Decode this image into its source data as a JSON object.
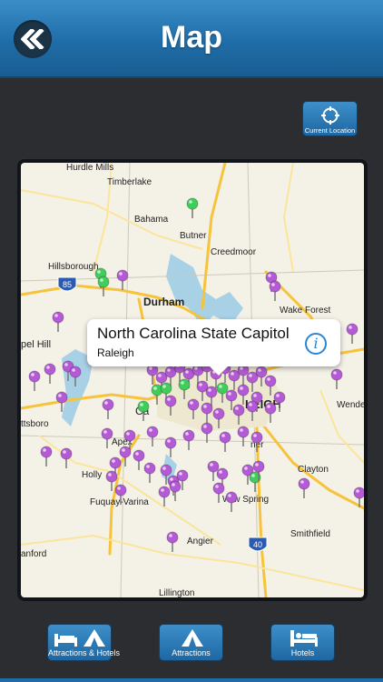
{
  "header": {
    "title": "Map",
    "back_icon": "double-chevron-left-icon"
  },
  "location_button": {
    "label": "Current Location",
    "icon": "crosshair-icon"
  },
  "callout": {
    "title": "North Carolina State Capitol",
    "subtitle": "Raleigh",
    "icon": "info-icon"
  },
  "map_labels": {
    "hurdle_mills": "Hurdle Mills",
    "timberlake": "Timberlake",
    "bahama": "Bahama",
    "butner": "Butner",
    "creedmoor": "Creedmoor",
    "hillsborough": "Hillsborough",
    "durham": "Durham",
    "wake_forest": "Wake Forest",
    "chapel_hill": "pel Hill",
    "raleigh": "LEIGH",
    "cary": "Ca",
    "apex": "Apex",
    "pittsboro": "ttsboro",
    "holly_springs": "Holly",
    "fuquay": "Fuquay-Varina",
    "garner": "ner",
    "clayton": "Clayton",
    "willow_spring": "W    w Spring",
    "angier": "Angier",
    "smithfield": "Smithfield",
    "sanford": "anford",
    "lillington": "Lillington",
    "wendell": "Wende",
    "i85": "85",
    "i40": "40"
  },
  "tabs": [
    {
      "label": "Attractions & Hotels",
      "icon": "bed-and-tent-icon"
    },
    {
      "label": "Attractions",
      "icon": "tent-icon"
    },
    {
      "label": "Hotels",
      "icon": "bed-icon"
    }
  ],
  "colors": {
    "nav": "#1f6da8",
    "pin_purple": "#b45ad6",
    "pin_green": "#3fce5a",
    "water": "#a9d1e6",
    "road": "#f6c33a"
  }
}
